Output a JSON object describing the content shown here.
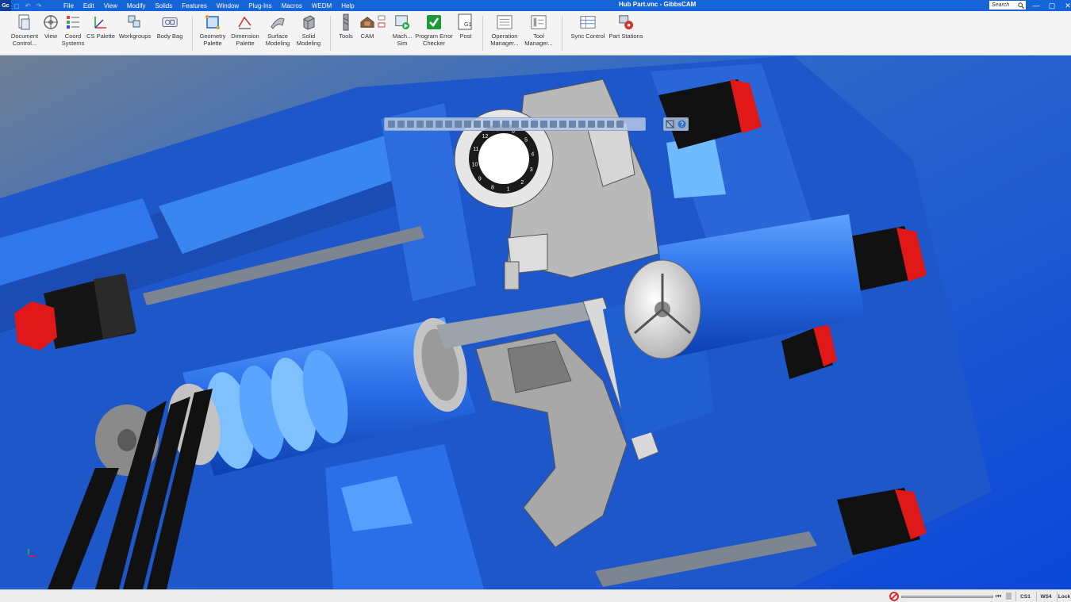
{
  "window": {
    "title": "Hub Part.vnc - GibbsCAM",
    "logo": "Gc"
  },
  "menu": [
    "File",
    "Edit",
    "View",
    "Modify",
    "Solids",
    "Features",
    "Window",
    "Plug-Ins",
    "Macros",
    "WEDM",
    "Help"
  ],
  "search": {
    "placeholder": "Search"
  },
  "ribbon": {
    "document_control": "Document Control...",
    "view": "View",
    "coord_systems": "Coord Systems",
    "cs_palette": "CS Palette",
    "workgroups": "Workgroups",
    "body_bag": "Body Bag",
    "geometry_palette": "Geometry Palette",
    "dimension_palette": "Dimension Palette",
    "surface_modeling": "Surface Modeling",
    "solid_modeling": "Solid Modeling",
    "tools": "Tools",
    "cam": "CAM",
    "mach_sim": "Mach... Sim",
    "program_error_checker": "Program Error Checker",
    "post": "Post",
    "post_badge": "G1",
    "operation_manager": "Operation Manager...",
    "tool_manager": "Tool Manager...",
    "sync_control": "Sync Control",
    "part_stations": "Part Stations"
  },
  "turret": {
    "station_numbers": [
      "7",
      "6",
      "5",
      "4",
      "3",
      "2",
      "1",
      "8",
      "9",
      "10",
      "11",
      "12"
    ]
  },
  "status": {
    "cs": "CS1",
    "ws": "WS4",
    "last": "Lock"
  },
  "colors": {
    "accent": "#1565d8",
    "machine_blue": "#1f5fd0",
    "stop_red": "#e01818"
  }
}
